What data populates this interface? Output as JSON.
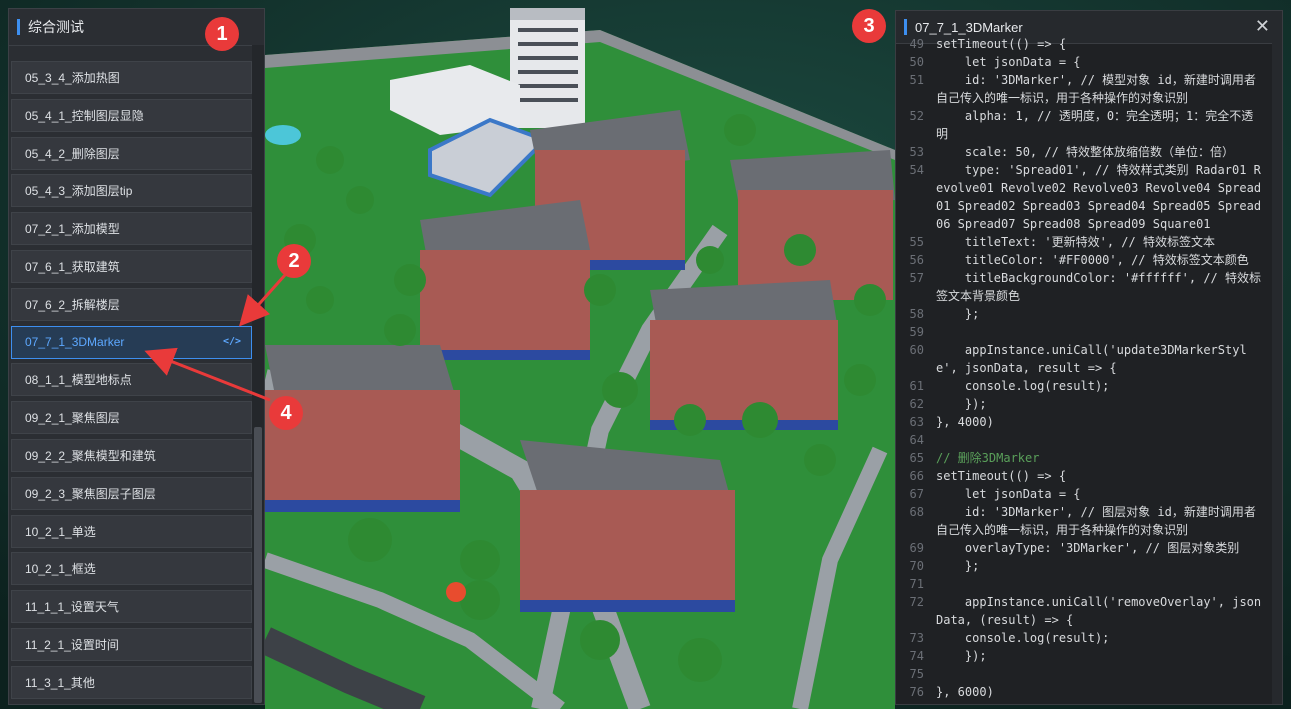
{
  "left_panel": {
    "title": "综合测试",
    "items": [
      {
        "label": "05_3_4_添加热图"
      },
      {
        "label": "05_4_1_控制图层显隐"
      },
      {
        "label": "05_4_2_删除图层"
      },
      {
        "label": "05_4_3_添加图层tip"
      },
      {
        "label": "07_2_1_添加模型"
      },
      {
        "label": "07_6_1_获取建筑"
      },
      {
        "label": "07_6_2_拆解楼层"
      },
      {
        "label": "07_7_1_3DMarker",
        "active": true,
        "icon": "code-icon",
        "icon_text": "</>"
      },
      {
        "label": "08_1_1_模型地标点"
      },
      {
        "label": "09_2_1_聚焦图层"
      },
      {
        "label": "09_2_2_聚焦模型和建筑"
      },
      {
        "label": "09_2_3_聚焦图层子图层"
      },
      {
        "label": "10_2_1_单选"
      },
      {
        "label": "10_2_1_框选"
      },
      {
        "label": "11_1_1_设置天气"
      },
      {
        "label": "11_2_1_设置时间"
      },
      {
        "label": "11_3_1_其他"
      }
    ]
  },
  "right_panel": {
    "title": "07_7_1_3DMarker",
    "close_symbol": "✕",
    "code_lines": [
      {
        "n": "49",
        "t": "setTimeout(() => {"
      },
      {
        "n": "50",
        "t": "    let jsonData = {"
      },
      {
        "n": "51",
        "t": "    id: '3DMarker', // 模型对象 id，新建时调用者自己传入的唯一标识，用于各种操作的对象识别"
      },
      {
        "n": "52",
        "t": "    alpha: 1, // 透明度，0：完全透明；1：完全不透明"
      },
      {
        "n": "53",
        "t": "    scale: 50, // 特效整体放缩倍数（单位：倍）"
      },
      {
        "n": "54",
        "t": "    type: 'Spread01', // 特效样式类别 Radar01 Revolve01 Revolve02 Revolve03 Revolve04 Spread01 Spread02 Spread03 Spread04 Spread05 Spread06 Spread07 Spread08 Spread09 Square01"
      },
      {
        "n": "55",
        "t": "    titleText: '更新特效', // 特效标签文本"
      },
      {
        "n": "56",
        "t": "    titleColor: '#FF0000', // 特效标签文本颜色"
      },
      {
        "n": "57",
        "t": "    titleBackgroundColor: '#ffffff', // 特效标签文本背景颜色"
      },
      {
        "n": "58",
        "t": "    };"
      },
      {
        "n": "59",
        "t": ""
      },
      {
        "n": "60",
        "t": "    appInstance.uniCall('update3DMarkerStyle', jsonData, result => {"
      },
      {
        "n": "61",
        "t": "    console.log(result);"
      },
      {
        "n": "62",
        "t": "    });"
      },
      {
        "n": "63",
        "t": "}, 4000)"
      },
      {
        "n": "64",
        "t": ""
      },
      {
        "n": "65",
        "t": "// 删除3DMarker",
        "comment": true
      },
      {
        "n": "66",
        "t": "setTimeout(() => {"
      },
      {
        "n": "67",
        "t": "    let jsonData = {"
      },
      {
        "n": "68",
        "t": "    id: '3DMarker', // 图层对象 id，新建时调用者自己传入的唯一标识，用于各种操作的对象识别"
      },
      {
        "n": "69",
        "t": "    overlayType: '3DMarker', // 图层对象类别"
      },
      {
        "n": "70",
        "t": "    };"
      },
      {
        "n": "71",
        "t": ""
      },
      {
        "n": "72",
        "t": "    appInstance.uniCall('removeOverlay', jsonData, (result) => {"
      },
      {
        "n": "73",
        "t": "    console.log(result);"
      },
      {
        "n": "74",
        "t": "    });"
      },
      {
        "n": "75",
        "t": ""
      },
      {
        "n": "76",
        "t": "}, 6000)"
      }
    ]
  },
  "markers": [
    "1",
    "2",
    "3",
    "4"
  ],
  "colors": {
    "accent": "#3d8ff0",
    "marker_red": "#e93a3a",
    "string_red": "#e8685a",
    "comment_green": "#5aa05a",
    "keyword_blue": "#5da8ff",
    "number_green": "#8fcf6a"
  }
}
